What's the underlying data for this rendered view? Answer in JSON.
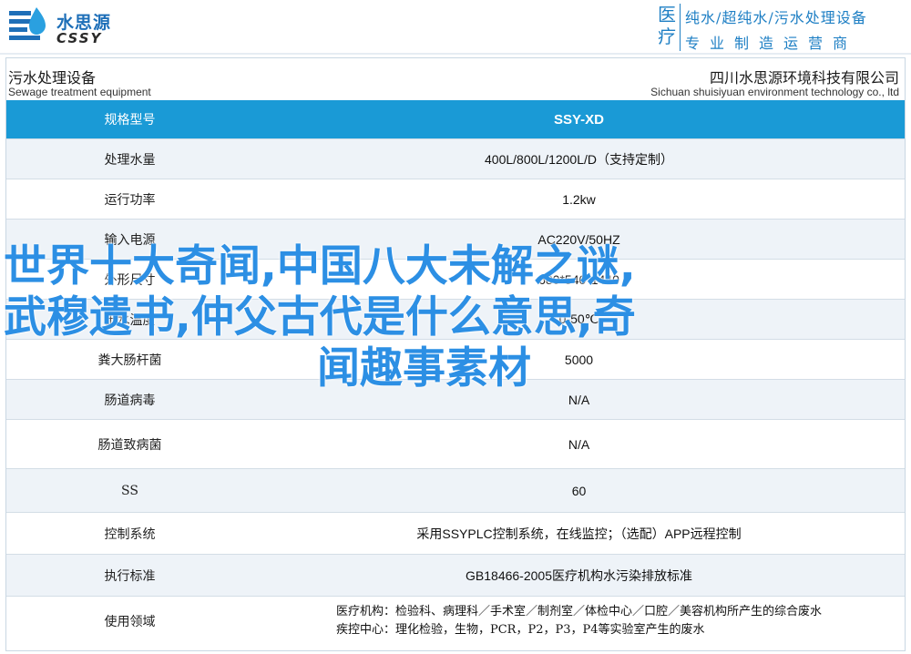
{
  "header": {
    "logo_cn": "水思源",
    "logo_en": "CSSY",
    "badge_top": "医",
    "badge_bottom": "疗",
    "slogan1": "纯水/超纯水/污水处理设备",
    "slogan2": "专业制造运营商"
  },
  "card": {
    "title_cn_left": "污水处理设备",
    "title_en_left": "Sewage treatment equipment",
    "title_cn_right": "四川水思源环境科技有限公司",
    "title_en_right": "Sichuan shuisiyuan environment technology co., ltd"
  },
  "specs": [
    {
      "key": "规格型号",
      "value": "SSY-XD"
    },
    {
      "key": "处理水量",
      "value": "400L/800L/1200L/D（支持定制）"
    },
    {
      "key": "运行功率",
      "value": "1.2kw"
    },
    {
      "key": "输入电源",
      "value": "AC220V/50HZ"
    },
    {
      "key": "外形尺寸",
      "value": "680*540*1440"
    },
    {
      "key": "出水温度",
      "value": "0-50℃"
    },
    {
      "key": "粪大肠杆菌",
      "value": "5000"
    },
    {
      "key": "肠道病毒",
      "value": "N/A"
    },
    {
      "key": "肠道致病菌",
      "value": "N/A"
    },
    {
      "key": "SS",
      "value": "60"
    },
    {
      "key": "控制系统",
      "value": "采用SSYPLC控制系统，在线监控；（选配）APP远程控制"
    },
    {
      "key": "执行标准",
      "value": "GB18466-2005医疗机构水污染排放标准"
    },
    {
      "key": "使用领域",
      "value_line1": "医疗机构：检验科、病理科／手术室／制剂室／体检中心／口腔／美容机构所产生的综合废水",
      "value_line2": "疾控中心：理化检验，生物，PCR，P2，P3，P4等实验室产生的废水"
    }
  ],
  "overlay": {
    "line1": "世界十大奇闻,中国八大未解之谜,",
    "line2": "武穆遗书,仲父古代是什么意思,奇",
    "line3": "闻趣事素材"
  }
}
